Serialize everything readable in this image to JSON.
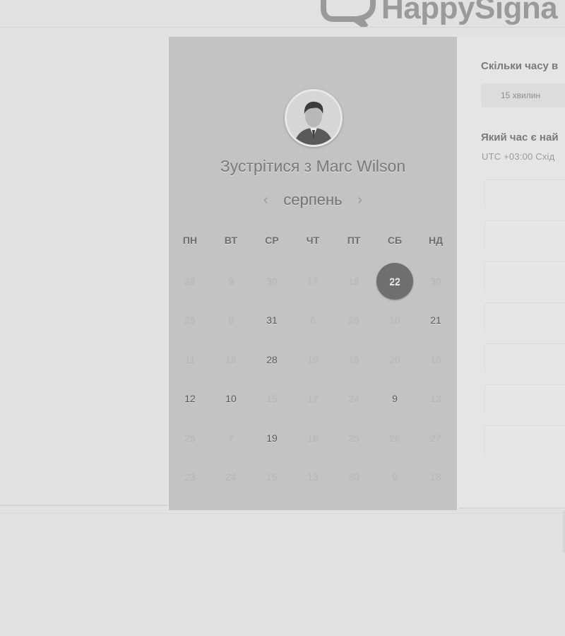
{
  "logo": {
    "text": "HappySigna",
    "icon": "speech-bubble-check-icon"
  },
  "calendar": {
    "avatar_icon": "person-avatar",
    "title": "Зустрітися з Marc Wilson",
    "month": "серпень",
    "prev_icon": "chevron-left-icon",
    "next_icon": "chevron-right-icon",
    "prev_symbol": "‹",
    "next_symbol": "›",
    "weekdays": [
      "ПН",
      "ВТ",
      "СР",
      "ЧТ",
      "ПТ",
      "СБ",
      "НД"
    ],
    "selected_day": "22",
    "days": [
      [
        "28",
        "9",
        "30",
        "17",
        "18",
        "22",
        "30"
      ],
      [
        "25",
        "8",
        "31",
        "6",
        "26",
        "10",
        "21"
      ],
      [
        "11",
        "18",
        "28",
        "19",
        "15",
        "20",
        "16"
      ],
      [
        "12",
        "10",
        "15",
        "17",
        "24",
        "9",
        "13"
      ],
      [
        "26",
        "7",
        "19",
        "16",
        "25",
        "26",
        "27"
      ],
      [
        "23",
        "24",
        "15",
        "13",
        "30",
        "9",
        "18"
      ]
    ],
    "available": [
      [
        false,
        false,
        false,
        false,
        false,
        true,
        false
      ],
      [
        false,
        false,
        true,
        false,
        false,
        false,
        true
      ],
      [
        false,
        false,
        true,
        false,
        false,
        false,
        false
      ],
      [
        true,
        true,
        false,
        false,
        false,
        true,
        false
      ],
      [
        false,
        false,
        true,
        false,
        false,
        false,
        false
      ],
      [
        false,
        false,
        false,
        false,
        false,
        false,
        false
      ]
    ]
  },
  "right": {
    "duration_question": "Скільки часу в",
    "duration_value": "15 хвилин",
    "time_question": "Який час є най",
    "timezone": "UTC +03:00 Схід"
  },
  "colors": {
    "panel": "#c3c3c3",
    "selected": "#6f6f6f",
    "background": "#e1e1e1"
  }
}
